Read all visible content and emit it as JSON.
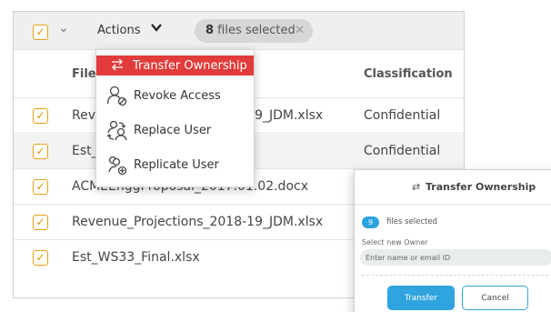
{
  "toolbar": {
    "actions_label": "Actions",
    "selected_count": "8",
    "selected_text": " files selected",
    "check_glyph": "✓",
    "chevron_glyph": "⌄",
    "close_glyph": "✕"
  },
  "table": {
    "headers": {
      "file": "File Name",
      "classification": "Classification"
    },
    "rows": [
      {
        "name": "Revenue_Projections_2018-19_JDM.xlsx",
        "classification": "Confidential",
        "checked": true
      },
      {
        "name": "Est_WS33_Final.xlsx",
        "classification": "Confidential",
        "checked": true
      },
      {
        "name": "ACMEEnggProposal_2017.01.02.docx",
        "classification": "",
        "checked": true
      },
      {
        "name": "Revenue_Projections_2018-19_JDM.xlsx",
        "classification": "",
        "checked": true
      },
      {
        "name": "Est_WS33_Final.xlsx",
        "classification": "",
        "checked": true
      }
    ]
  },
  "menu": {
    "items": [
      {
        "label": "Transfer Ownership",
        "icon": "transfer-icon",
        "active": true
      },
      {
        "label": "Revoke Access",
        "icon": "revoke-user-icon",
        "active": false
      },
      {
        "label": "Replace User",
        "icon": "replace-user-icon",
        "active": false
      },
      {
        "label": "Replicate User",
        "icon": "replicate-user-icon",
        "active": false
      }
    ]
  },
  "dialog": {
    "title": "Transfer Ownership",
    "title_icon_glyph": "⇄",
    "count": "9",
    "files_selected_text": "files selected",
    "owner_label": "Select new Owner",
    "owner_placeholder": "Enter name or email ID",
    "owner_value": "",
    "transfer_label": "Transfer",
    "cancel_label": "Cancel"
  },
  "colors": {
    "accent_red": "#e23b3b",
    "accent_blue": "#2fa4de",
    "checkbox_orange": "#e6a017"
  }
}
